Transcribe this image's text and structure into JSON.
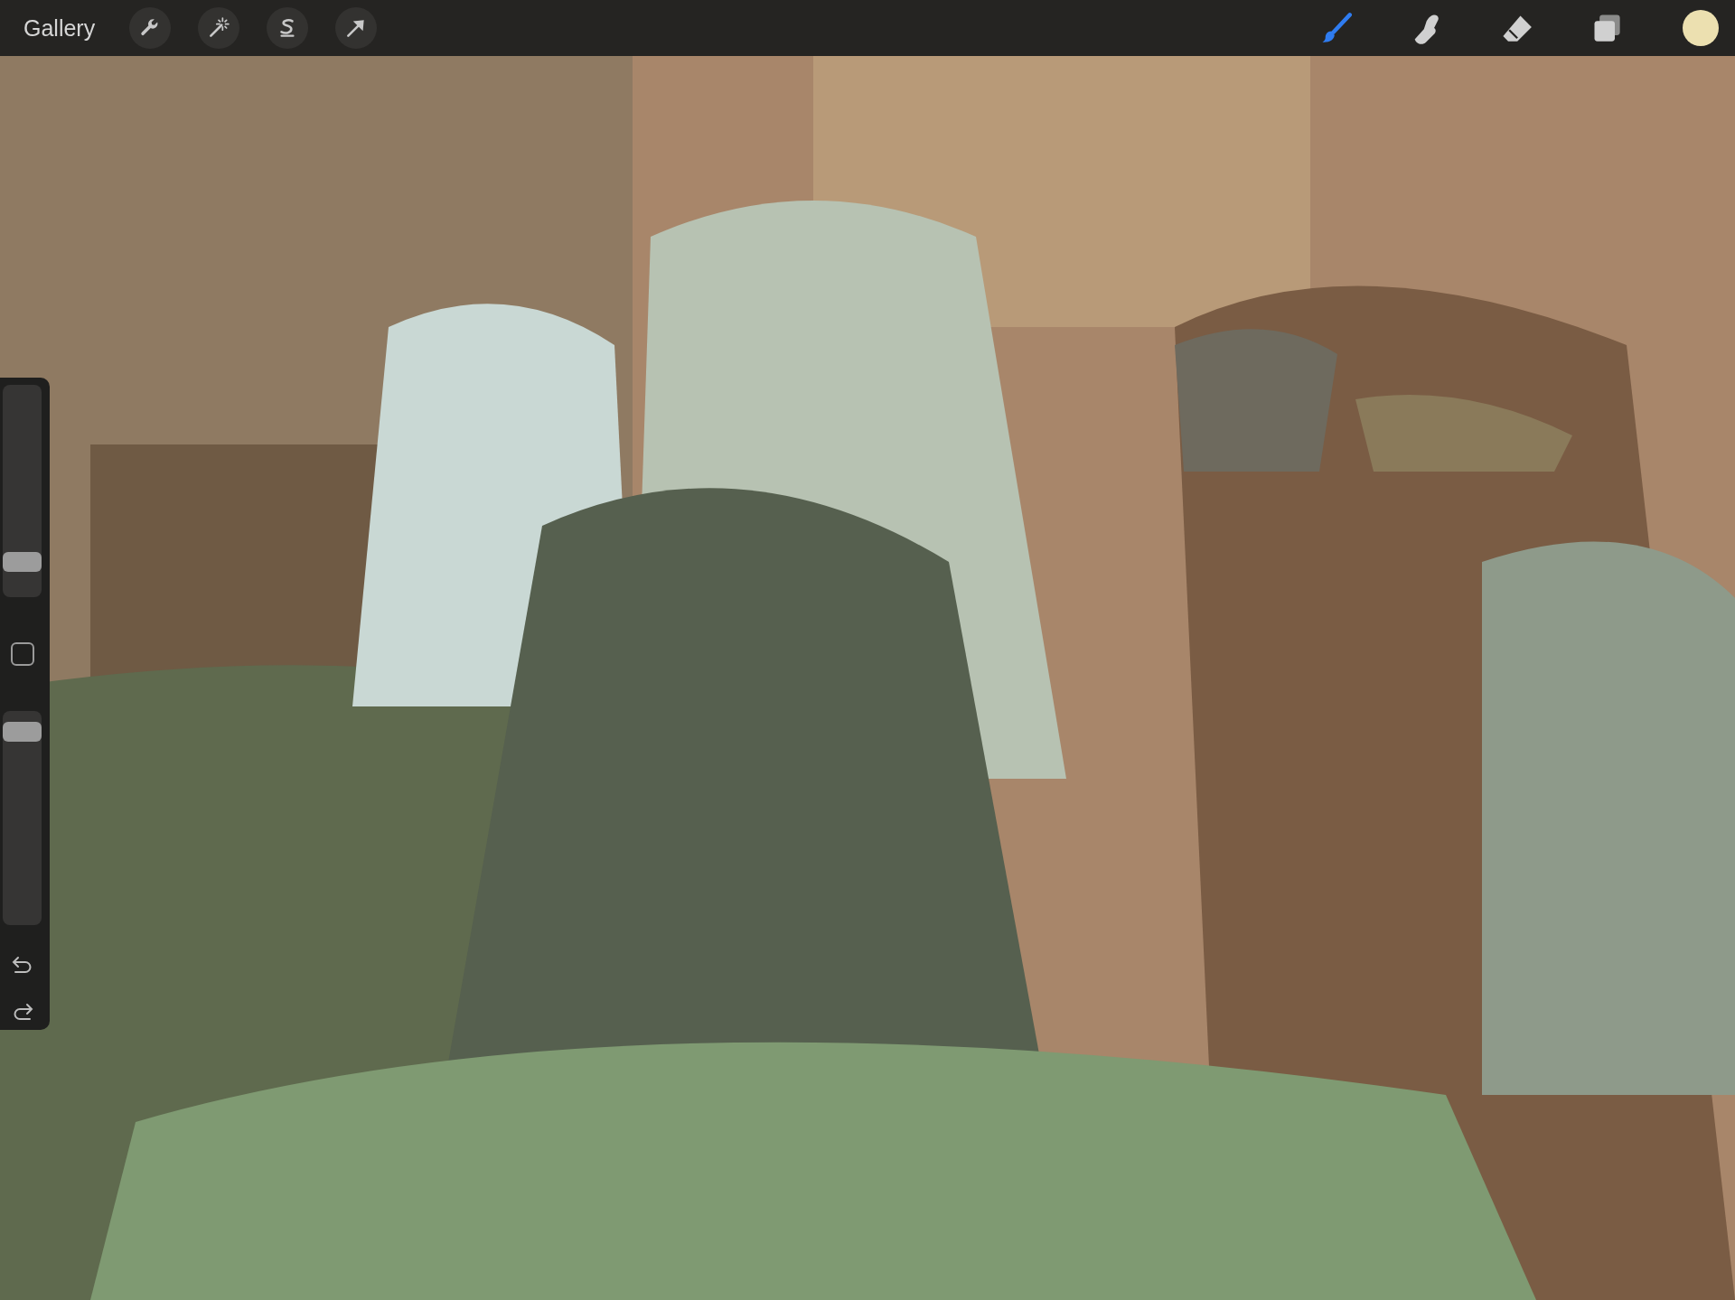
{
  "toolbar": {
    "gallery": "Gallery",
    "actions": [
      {
        "kind": "wrench"
      },
      {
        "kind": "wand"
      },
      {
        "kind": "selection"
      },
      {
        "kind": "transform"
      }
    ],
    "tools": [
      {
        "kind": "brush",
        "selected": true
      },
      {
        "kind": "smudge",
        "selected": false
      },
      {
        "kind": "eraser",
        "selected": false
      },
      {
        "kind": "layers",
        "selected": false
      }
    ],
    "current_color": {
      "color": "#ece0b0"
    }
  },
  "sidebar": {
    "sliders": [
      {
        "level": 0.12
      },
      {
        "level": 0.95
      }
    ]
  }
}
